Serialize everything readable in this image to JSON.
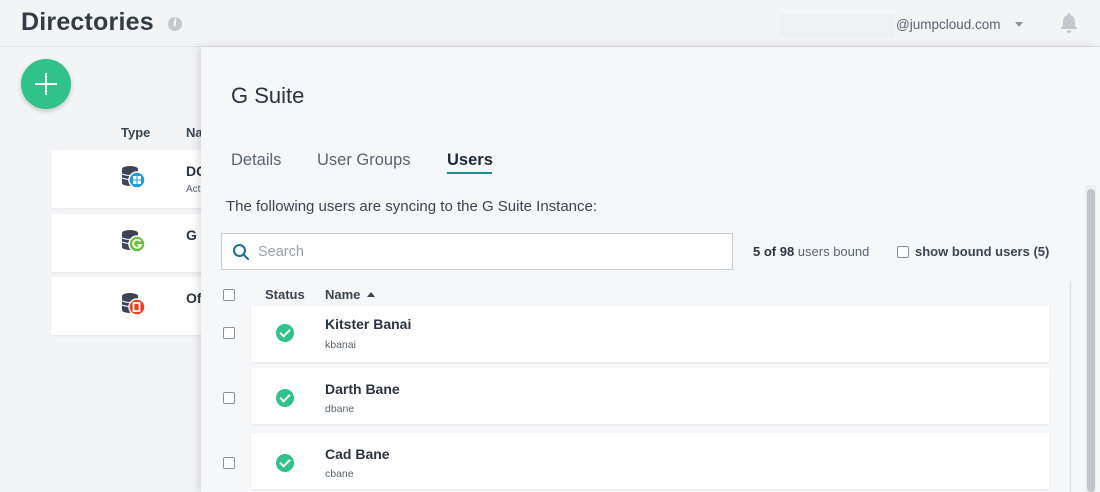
{
  "header": {
    "title": "Directories",
    "user_email": "@jumpcloud.com"
  },
  "directories": {
    "col_type": "Type",
    "col_name": "Na",
    "rows": [
      {
        "name": "DC",
        "subtitle": "Act",
        "icon": "windows-directory-icon",
        "color": "#1e9be0"
      },
      {
        "name": "G",
        "subtitle": "",
        "icon": "gsuite-directory-icon",
        "color": "#6cc13a"
      },
      {
        "name": "Of",
        "subtitle": "",
        "icon": "office365-directory-icon",
        "color": "#e8421c"
      }
    ]
  },
  "panel": {
    "title": "G Suite",
    "tabs": [
      {
        "label": "Details",
        "active": false
      },
      {
        "label": "User Groups",
        "active": false
      },
      {
        "label": "Users",
        "active": true
      }
    ],
    "sync_text": "The following users are syncing to the G Suite Instance:",
    "search_placeholder": "Search",
    "bound_count_num": "5 of 98",
    "bound_count_suffix": " users bound",
    "show_bound_label": "show bound users (5)",
    "columns": {
      "status": "Status",
      "name": "Name"
    },
    "users": [
      {
        "name": "Kitster Banai",
        "login": "kbanai",
        "status": "bound"
      },
      {
        "name": "Darth Bane",
        "login": "dbane",
        "status": "bound"
      },
      {
        "name": "Cad Bane",
        "login": "cbane",
        "status": "bound"
      }
    ]
  },
  "colors": {
    "accent_green": "#2fc38b",
    "tab_underline": "#1a8c96"
  }
}
